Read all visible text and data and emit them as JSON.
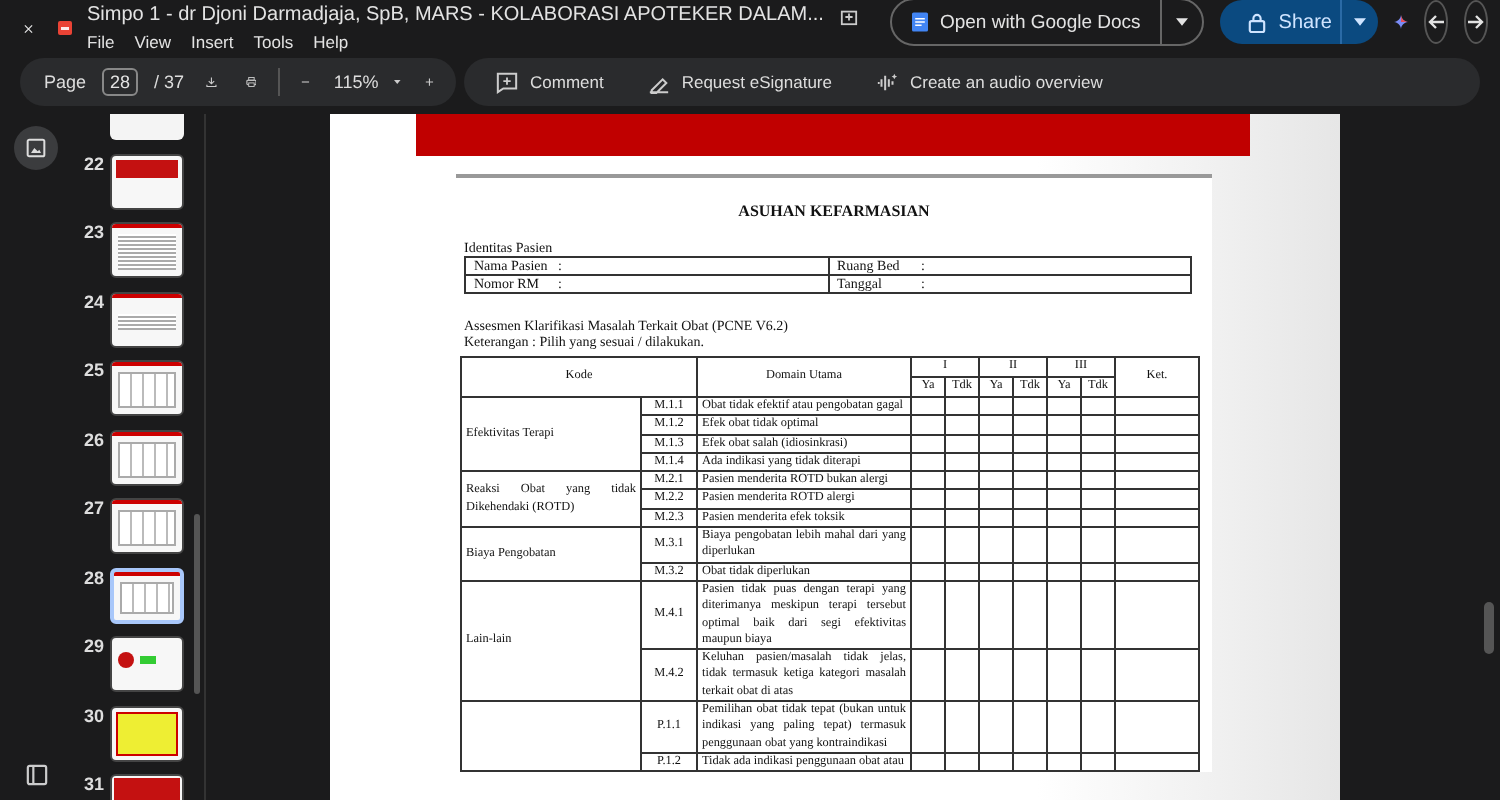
{
  "window": {
    "title": "Simpo 1 -  dr Djoni Darmadjaja, SpB, MARS  -  KOLABORASI APOTEKER DALAM...",
    "menu": [
      "File",
      "View",
      "Insert",
      "Tools",
      "Help"
    ]
  },
  "header_buttons": {
    "open_with": "Open with Google Docs",
    "share": "Share"
  },
  "toolbar": {
    "page_label": "Page",
    "page_value": "28",
    "page_total": "/ 37",
    "zoom": "115%",
    "actions": [
      {
        "kind": "comment",
        "label": "Comment"
      },
      {
        "kind": "signature",
        "label": "Request eSignature"
      },
      {
        "kind": "audio",
        "label": "Create an audio overview"
      }
    ]
  },
  "thumbnails": [
    {
      "number": "22",
      "kind": "title",
      "selected": false
    },
    {
      "number": "23",
      "kind": "list",
      "selected": false
    },
    {
      "number": "24",
      "kind": "title-list",
      "selected": false
    },
    {
      "number": "25",
      "kind": "table",
      "selected": false
    },
    {
      "number": "26",
      "kind": "table",
      "selected": false
    },
    {
      "number": "27",
      "kind": "table",
      "selected": false
    },
    {
      "number": "28",
      "kind": "table",
      "selected": true
    },
    {
      "number": "29",
      "kind": "diagram",
      "selected": false
    },
    {
      "number": "30",
      "kind": "yellow",
      "selected": false
    },
    {
      "number": "31",
      "kind": "red",
      "selected": false
    }
  ],
  "document": {
    "title": "ASUHAN KEFARMASIAN",
    "identity_heading": "Identitas Pasien",
    "identity_fields": [
      {
        "label": "Nama Pasien",
        "colon": ":"
      },
      {
        "label": "Ruang Bed",
        "colon": ":"
      },
      {
        "label": "Nomor RM",
        "colon": ":"
      },
      {
        "label": "Tanggal",
        "colon": ":"
      }
    ],
    "assessment_title": "Assesmen Klarifikasi Masalah Terkait Obat (PCNE V6.2)",
    "note": "Keterangan : Pilih yang sesuai / dilakukan.",
    "table": {
      "kode": "Kode",
      "domain": "Domain Utama",
      "groups": [
        "I",
        "II",
        "III"
      ],
      "subs": [
        "Ya",
        "Tdk",
        "Ya",
        "Tdk",
        "Ya",
        "Tdk"
      ],
      "ket": "Ket.",
      "sections": [
        {
          "name": "Efektivitas Terapi",
          "rows": [
            {
              "code": "M.1.1",
              "text": "Obat tidak efektif atau pengobatan gagal"
            },
            {
              "code": "M.1.2",
              "text": "Efek obat tidak optimal"
            },
            {
              "code": "M.1.3",
              "text": "Efek obat salah (idiosinkrasi)"
            },
            {
              "code": "M.1.4",
              "text": "Ada indikasi yang tidak diterapi"
            }
          ]
        },
        {
          "name": "Reaksi Obat yang tidak Dikehendaki (ROTD)",
          "rows": [
            {
              "code": "M.2.1",
              "text": "Pasien menderita ROTD bukan alergi"
            },
            {
              "code": "M.2.2",
              "text": "Pasien menderita ROTD alergi"
            },
            {
              "code": "M.2.3",
              "text": "Pasien menderita efek toksik"
            }
          ]
        },
        {
          "name": "Biaya Pengobatan",
          "rows": [
            {
              "code": "M.3.1",
              "text": "Biaya pengobatan lebih mahal dari yang diperlukan"
            },
            {
              "code": "M.3.2",
              "text": "Obat tidak diperlukan"
            }
          ]
        },
        {
          "name": "Lain-lain",
          "rows": [
            {
              "code": "M.4.1",
              "text": "Pasien tidak puas dengan terapi yang diterimanya meskipun terapi tersebut optimal baik dari segi efektivitas maupun biaya"
            },
            {
              "code": "M.4.2",
              "text": "Keluhan pasien/masalah tidak jelas, tidak termasuk ketiga kategori masalah terkait obat di atas"
            }
          ]
        },
        {
          "rows": [
            {
              "code": "P.1.1",
              "text": "Pemilihan obat tidak tepat (bukan untuk indikasi yang paling tepat) termasuk penggunaan obat yang kontraindikasi"
            },
            {
              "code": "P.1.2",
              "text": "Tidak ada indikasi penggunaan obat atau"
            }
          ]
        }
      ]
    }
  }
}
